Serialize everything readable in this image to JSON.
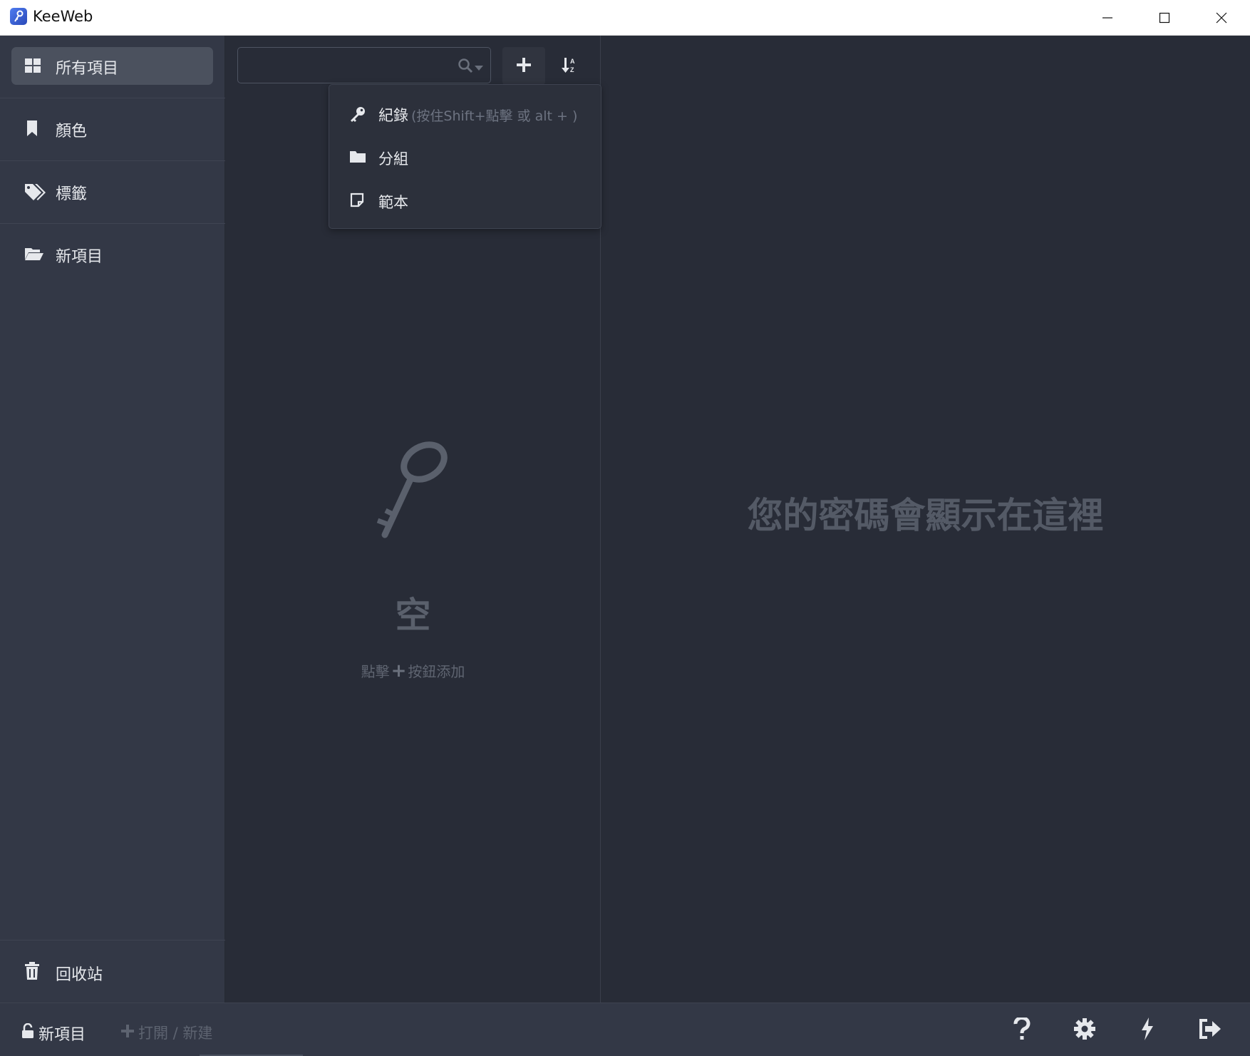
{
  "window": {
    "title": "KeeWeb"
  },
  "sidebar": {
    "items": [
      {
        "label": "所有項目",
        "icon": "grid-icon",
        "active": true
      },
      {
        "label": "顏色",
        "icon": "bookmark-icon"
      },
      {
        "label": "標籤",
        "icon": "tags-icon"
      },
      {
        "label": "新項目",
        "icon": "folder-open-icon"
      }
    ],
    "trash": {
      "label": "回收站",
      "icon": "trash-icon"
    }
  },
  "list": {
    "search": {
      "placeholder": "",
      "value": ""
    },
    "dropdown": {
      "items": [
        {
          "label": "紀錄",
          "hint": "(按住Shift+點擊 或 alt + )",
          "icon": "key-icon"
        },
        {
          "label": "分組",
          "icon": "folder-icon"
        },
        {
          "label": "範本",
          "icon": "note-icon"
        }
      ]
    },
    "empty": {
      "title": "空",
      "sub_before": "點擊",
      "sub_after": "按鈕添加"
    }
  },
  "detail": {
    "placeholder": "您的密碼會顯示在這裡"
  },
  "footer": {
    "db_label": "新項目",
    "open_label": "打開 / 新建"
  },
  "colors": {
    "bg": "#282c37",
    "sidebar": "#333846",
    "text": "#e6e8ec",
    "muted": "#5f6571"
  }
}
